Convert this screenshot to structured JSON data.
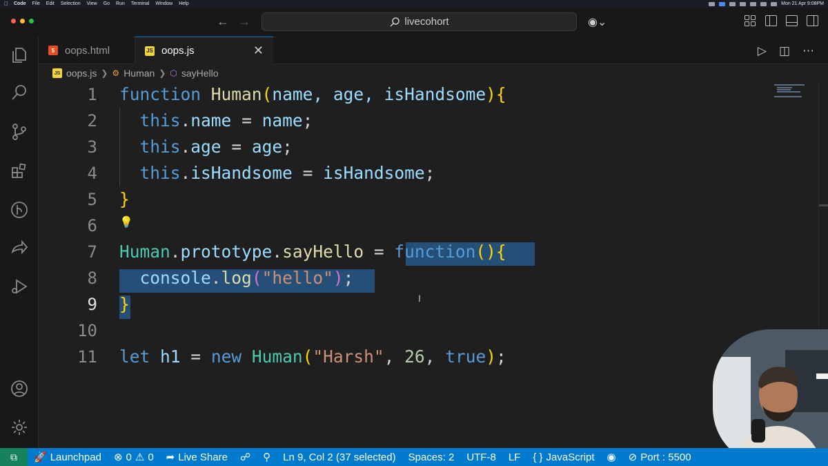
{
  "menubar": {
    "app": "Code",
    "items": [
      "File",
      "Edit",
      "Selection",
      "View",
      "Go",
      "Run",
      "Terminal",
      "Window",
      "Help"
    ],
    "clock": "Mon 21 Apr  9:08PM"
  },
  "titlebar": {
    "search_label": "livecohort"
  },
  "tabs": [
    {
      "label": "oops.html",
      "icon": "html5-icon",
      "badge": "5"
    },
    {
      "label": "oops.js",
      "icon": "js-icon",
      "badge": "JS"
    }
  ],
  "breadcrumb": [
    "oops.js",
    "Human",
    "sayHello"
  ],
  "editor": {
    "line_numbers": [
      "1",
      "2",
      "3",
      "4",
      "5",
      "6",
      "7",
      "8",
      "9",
      "10",
      "11"
    ],
    "current_line": 9,
    "code": {
      "l1": {
        "kw": "function",
        "name": "Human",
        "params": "name, age, isHandsome"
      },
      "l2": {
        "this": "this",
        "prop": "name",
        "val": "name"
      },
      "l3": {
        "this": "this",
        "prop": "age",
        "val": "age"
      },
      "l4": {
        "this": "this",
        "prop": "isHandsome",
        "val": "isHandsome"
      },
      "l7": {
        "obj": "Human",
        "proto": "prototype",
        "method": "sayHello",
        "kw": "function"
      },
      "l8": {
        "obj": "console",
        "fn": "log",
        "str": "\"hello\""
      },
      "l11": {
        "kw_let": "let",
        "var": "h1",
        "kw_new": "new",
        "cls": "Human",
        "str": "\"Harsh\"",
        "num": "26",
        "bool": "true"
      }
    }
  },
  "statusbar": {
    "launchpad": "Launchpad",
    "errors": "0",
    "warnings": "0",
    "live_share": "Live Share",
    "position": "Ln 9, Col 2 (37 selected)",
    "spaces": "Spaces: 2",
    "encoding": "UTF-8",
    "eol": "LF",
    "language": "JavaScript",
    "port": "Port : 5500"
  },
  "colors": {
    "statusbar": "#007acc",
    "remote": "#16825d",
    "selection": "#264f78",
    "keyword": "#569cd6",
    "function": "#dcdcaa",
    "class": "#4ec9b0",
    "string": "#ce9178"
  }
}
